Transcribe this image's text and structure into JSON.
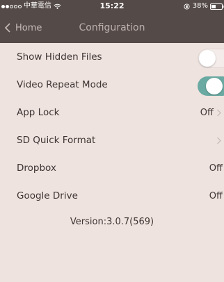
{
  "status_bar": {
    "carrier": "中華電信",
    "time": "15:22",
    "battery": "38%",
    "signal_dots_filled": 2,
    "signal_dots_total": 5
  },
  "nav": {
    "back_label": "Home",
    "title": "Configuration"
  },
  "settings": {
    "items": [
      {
        "label": "Show Hidden Files",
        "control": "toggle",
        "state": "off"
      },
      {
        "label": "Video Repeat Mode",
        "control": "toggle",
        "state": "on"
      },
      {
        "label": "App Lock",
        "control": "value-chevron",
        "value": "Off"
      },
      {
        "label": "SD Quick Format",
        "control": "chevron"
      },
      {
        "label": "Dropbox",
        "control": "value",
        "value": "Off"
      },
      {
        "label": "Google Drive",
        "control": "value",
        "value": "Off"
      }
    ]
  },
  "version_text": "Version:3.0.7(569)",
  "colors": {
    "background": "#efe3df",
    "bar": "#544a47",
    "toggle_on": "#6aaaa2",
    "text": "#3d3533"
  },
  "icons": [
    "wifi-icon",
    "rotation-lock-icon",
    "battery-icon",
    "back-chevron-icon",
    "chevron-right-icon"
  ]
}
